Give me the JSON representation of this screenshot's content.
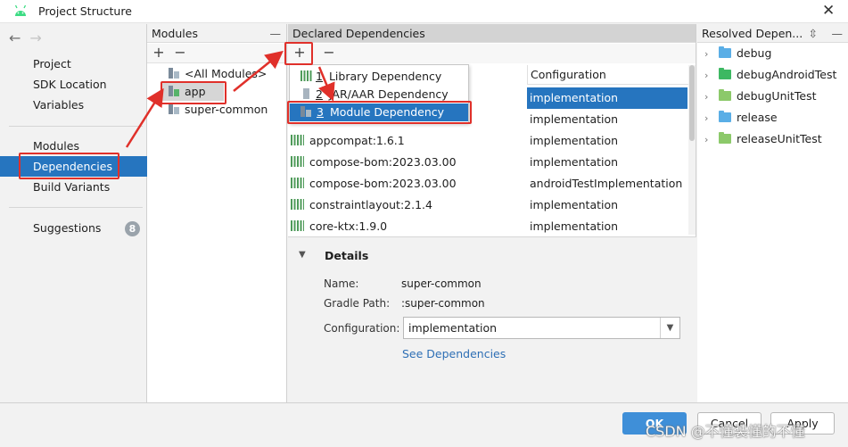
{
  "window": {
    "title": "Project Structure"
  },
  "left_nav": {
    "top_items": [
      {
        "label": "Project"
      },
      {
        "label": "SDK Location"
      },
      {
        "label": "Variables"
      }
    ],
    "mid_items": [
      {
        "label": "Modules"
      },
      {
        "label": "Dependencies",
        "selected": true
      },
      {
        "label": "Build Variants"
      }
    ],
    "suggestions": {
      "label": "Suggestions",
      "count": "8"
    }
  },
  "modules": {
    "header": "Modules",
    "add": "+",
    "remove": "−",
    "items": [
      {
        "label": "<All Modules>"
      },
      {
        "label": "app",
        "selected": true
      },
      {
        "label": "super-common"
      }
    ]
  },
  "dependencies": {
    "header": "Declared Dependencies",
    "add": "+",
    "remove": "−",
    "column_configuration": "Configuration",
    "rows": [
      {
        "name": "",
        "configuration": "implementation",
        "selected": true
      },
      {
        "name": "",
        "configuration": "implementation"
      },
      {
        "name": "appcompat:1.6.1",
        "configuration": "implementation"
      },
      {
        "name": "compose-bom:2023.03.00",
        "configuration": "implementation"
      },
      {
        "name": "compose-bom:2023.03.00",
        "configuration": "androidTestImplementation"
      },
      {
        "name": "constraintlayout:2.1.4",
        "configuration": "implementation"
      },
      {
        "name": "core-ktx:1.9.0",
        "configuration": "implementation"
      }
    ],
    "popup": [
      {
        "num": "1",
        "label": "Library Dependency"
      },
      {
        "num": "2",
        "label": "JAR/AAR Dependency"
      },
      {
        "num": "3",
        "label": "Module Dependency",
        "selected": true
      }
    ]
  },
  "details": {
    "title": "Details",
    "name_label": "Name:",
    "name_value": "super-common",
    "path_label": "Gradle Path:",
    "path_value": ":super-common",
    "config_label": "Configuration:",
    "config_value": "implementation",
    "link": "See Dependencies"
  },
  "resolved": {
    "header": "Resolved Depen...",
    "items": [
      {
        "label": "debug",
        "color": "#5aaee6"
      },
      {
        "label": "debugAndroidTest",
        "color": "#3db862"
      },
      {
        "label": "debugUnitTest",
        "color": "#8cc96a"
      },
      {
        "label": "release",
        "color": "#5aaee6"
      },
      {
        "label": "releaseUnitTest",
        "color": "#8cc96a"
      }
    ]
  },
  "footer": {
    "ok": "OK",
    "cancel": "Cancel",
    "apply": "Apply"
  },
  "watermark": "CSDN @不懂装懂的不懂",
  "colors": {
    "selection": "#2675bf",
    "annotation": "#e0302a",
    "link": "#2e6fb5"
  }
}
